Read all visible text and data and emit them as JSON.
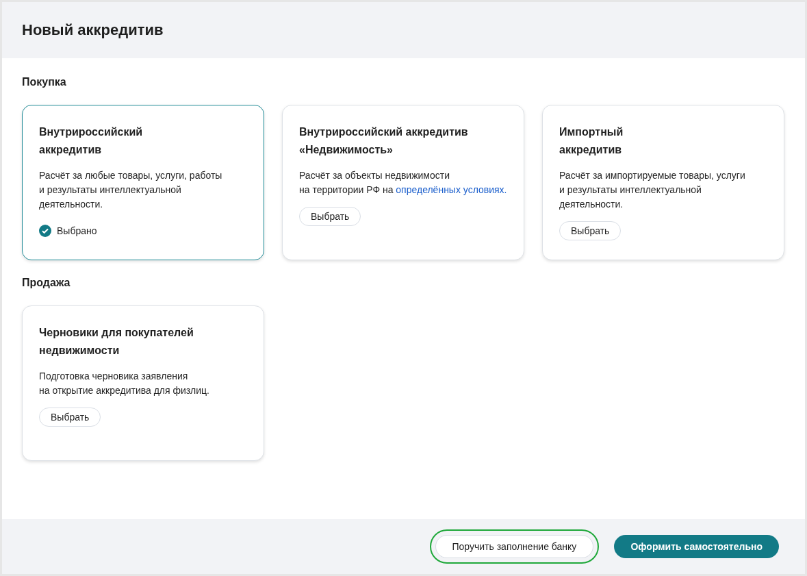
{
  "window": {
    "title": "Новый аккредитив"
  },
  "sections": [
    {
      "title": "Покупка",
      "cards": [
        {
          "title": "Внутрироссийский\nаккредитив",
          "description": "Расчёт за любые товары, услуги, работы\nи результаты интеллектуальной\nдеятельности.",
          "selected": true,
          "action": "Выбрано"
        },
        {
          "title": "Внутрироссийский аккредитив\n«Недвижимость»",
          "description": "Расчёт за объекты недвижимости\nна территории РФ на",
          "link": "определённых условиях.",
          "selected": false,
          "action": "Выбрать"
        },
        {
          "title": "Импортный\nаккредитив",
          "description": "Расчёт за импортируемые товары, услуги\nи результаты интеллектуальной\nдеятельности.",
          "selected": false,
          "action": "Выбрать"
        }
      ]
    },
    {
      "title": "Продажа",
      "cards": [
        {
          "title": "Черновики для покупателей\nнедвижимости",
          "description": "Подготовка черновика заявления\nна открытие аккредитива для физлиц.",
          "selected": false,
          "action": "Выбрать"
        }
      ]
    }
  ],
  "footer": {
    "buttons": [
      {
        "label": "Поручить заполнение банку",
        "kind": "secondary",
        "highlighted": true
      },
      {
        "label": "Оформить самостоятельно",
        "kind": "primary",
        "highlighted": false
      }
    ]
  }
}
